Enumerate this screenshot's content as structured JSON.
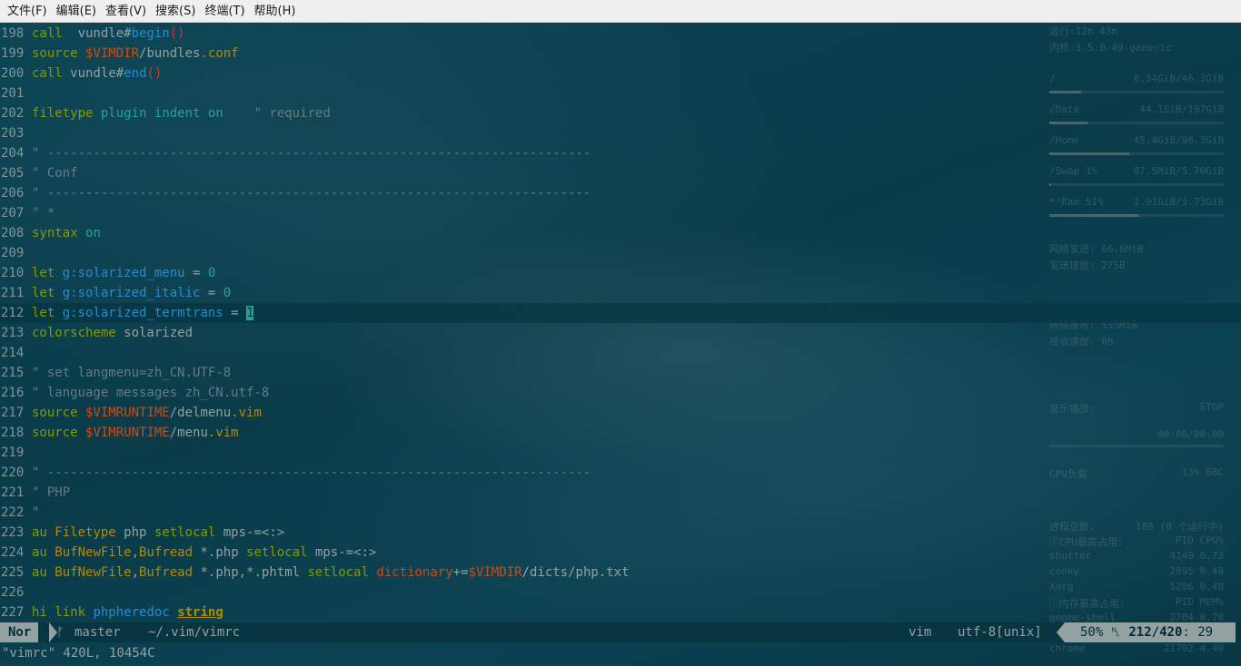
{
  "menu": [
    "文件(F)",
    "编辑(E)",
    "查看(V)",
    "搜索(S)",
    "终端(T)",
    "帮助(H)"
  ],
  "editor": {
    "lines": [
      {
        "n": "198",
        "segs": [
          [
            "kw",
            "call"
          ],
          [
            "",
            "  vundle#"
          ],
          [
            "fn",
            "begin"
          ],
          [
            "pr",
            "()"
          ]
        ]
      },
      {
        "n": "199",
        "segs": [
          [
            "kw",
            "source"
          ],
          [
            "",
            " "
          ],
          [
            "vr",
            "$VIMDIR"
          ],
          [
            "",
            "/bundles"
          ],
          [
            "ty",
            ".conf"
          ]
        ]
      },
      {
        "n": "200",
        "segs": [
          [
            "kw",
            "call"
          ],
          [
            "",
            " vundle#"
          ],
          [
            "fn",
            "end"
          ],
          [
            "pr",
            "()"
          ]
        ]
      },
      {
        "n": "201",
        "segs": []
      },
      {
        "n": "202",
        "segs": [
          [
            "kw",
            "filetype"
          ],
          [
            "",
            " "
          ],
          [
            "nm",
            "plugin"
          ],
          [
            "",
            " "
          ],
          [
            "nm",
            "indent"
          ],
          [
            "",
            " "
          ],
          [
            "nm",
            "on"
          ],
          [
            "cm",
            "    \" required"
          ]
        ]
      },
      {
        "n": "203",
        "segs": []
      },
      {
        "n": "204",
        "segs": [
          [
            "cm",
            "\" -----------------------------------------------------------------------"
          ]
        ]
      },
      {
        "n": "205",
        "segs": [
          [
            "cm",
            "\" Conf"
          ]
        ]
      },
      {
        "n": "206",
        "segs": [
          [
            "cm",
            "\" -----------------------------------------------------------------------"
          ]
        ]
      },
      {
        "n": "207",
        "segs": [
          [
            "cm",
            "\" *"
          ]
        ]
      },
      {
        "n": "208",
        "segs": [
          [
            "kw",
            "syntax"
          ],
          [
            "",
            " "
          ],
          [
            "nm",
            "on"
          ]
        ]
      },
      {
        "n": "209",
        "segs": []
      },
      {
        "n": "210",
        "segs": [
          [
            "kw",
            "let"
          ],
          [
            "",
            " "
          ],
          [
            "id",
            "g:solarized_menu"
          ],
          [
            "",
            " = "
          ],
          [
            "nm",
            "0"
          ]
        ]
      },
      {
        "n": "211",
        "segs": [
          [
            "kw",
            "let"
          ],
          [
            "",
            " "
          ],
          [
            "id",
            "g:solarized_italic"
          ],
          [
            "",
            " = "
          ],
          [
            "nm",
            "0"
          ]
        ]
      },
      {
        "n": "212",
        "current": true,
        "segs": [
          [
            "kw",
            "let"
          ],
          [
            "",
            " "
          ],
          [
            "id",
            "g:solarized_termtrans"
          ],
          [
            "",
            " = "
          ],
          [
            "cursor",
            "1"
          ]
        ]
      },
      {
        "n": "213",
        "segs": [
          [
            "kw",
            "colorscheme"
          ],
          [
            "",
            " solarized"
          ]
        ]
      },
      {
        "n": "214",
        "segs": []
      },
      {
        "n": "215",
        "segs": [
          [
            "cm",
            "\" set langmenu=zh_CN.UTF-8"
          ]
        ]
      },
      {
        "n": "216",
        "segs": [
          [
            "cm",
            "\" language messages zh_CN.utf-8"
          ]
        ]
      },
      {
        "n": "217",
        "segs": [
          [
            "kw",
            "source"
          ],
          [
            "",
            " "
          ],
          [
            "vr",
            "$VIMRUNTIME"
          ],
          [
            "",
            "/delmenu"
          ],
          [
            "ty",
            ".vim"
          ]
        ]
      },
      {
        "n": "218",
        "segs": [
          [
            "kw",
            "source"
          ],
          [
            "",
            " "
          ],
          [
            "vr",
            "$VIMRUNTIME"
          ],
          [
            "",
            "/menu"
          ],
          [
            "ty",
            ".vim"
          ]
        ]
      },
      {
        "n": "219",
        "segs": []
      },
      {
        "n": "220",
        "segs": [
          [
            "cm",
            "\" -----------------------------------------------------------------------"
          ]
        ]
      },
      {
        "n": "221",
        "segs": [
          [
            "cm",
            "\" PHP"
          ]
        ]
      },
      {
        "n": "222",
        "segs": [
          [
            "cm",
            "\""
          ]
        ]
      },
      {
        "n": "223",
        "segs": [
          [
            "kw",
            "au"
          ],
          [
            "",
            " "
          ],
          [
            "ty",
            "Filetype"
          ],
          [
            "",
            " php "
          ],
          [
            "kw",
            "setlocal"
          ],
          [
            "",
            " mps-=<:>"
          ]
        ]
      },
      {
        "n": "224",
        "segs": [
          [
            "kw",
            "au"
          ],
          [
            "",
            " "
          ],
          [
            "ty",
            "BufNewFile"
          ],
          [
            "",
            ","
          ],
          [
            "ty",
            "Bufread"
          ],
          [
            "",
            " *.php "
          ],
          [
            "kw",
            "setlocal"
          ],
          [
            "",
            " mps-=<:>"
          ]
        ]
      },
      {
        "n": "225",
        "segs": [
          [
            "kw",
            "au"
          ],
          [
            "",
            " "
          ],
          [
            "ty",
            "BufNewFile"
          ],
          [
            "",
            ","
          ],
          [
            "ty",
            "Bufread"
          ],
          [
            "",
            " *.php,*.phtml "
          ],
          [
            "kw",
            "setlocal"
          ],
          [
            "",
            " "
          ],
          [
            "vr",
            "dictionary"
          ],
          [
            "",
            "+="
          ],
          [
            "vr",
            "$VIMDIR"
          ],
          [
            "",
            "/dicts/php.txt"
          ]
        ]
      },
      {
        "n": "226",
        "segs": []
      },
      {
        "n": "227",
        "segs": [
          [
            "kw",
            "hi"
          ],
          [
            "",
            " "
          ],
          [
            "kw",
            "link"
          ],
          [
            "",
            " "
          ],
          [
            "id",
            "phpheredoc"
          ],
          [
            "",
            " "
          ],
          [
            "ul",
            "string"
          ]
        ]
      }
    ]
  },
  "conky": {
    "uptime": "运行:12h 43m",
    "kernel": "内核:3.5.0-49-generic",
    "root_label": "/",
    "root_usage": "8.34GiB/46.3GiB",
    "root_fill": 0.18,
    "data_label": "/Data",
    "data_usage": "44.1GiB/197GiB",
    "data_fill": 0.22,
    "home_label": "/Home",
    "home_usage": "45.4GiB/98.3GiB",
    "home_fill": 0.46,
    "swap_label": "/Swap  1%",
    "swap_usage": "87.5MiB/5.70GiB",
    "swap_fill": 0.01,
    "ram_label": "**Ram  51%",
    "ram_usage": "1.91GiB/3.73GiB",
    "ram_fill": 0.51,
    "net_sent": "网络发送: 66.6MiB",
    "up_speed": "发送速度: 275B",
    "net_recv": "网络接收: 555MiB",
    "down_speed": "接收速度: 0B",
    "music_label": "音乐播放:",
    "music_state": "STOP",
    "music_time": "00:00/00:00",
    "cpu_label": "CPU负载",
    "cpu_value": "13% 68C",
    "proc_total_label": "进程总数:",
    "proc_total": "188  (0 个运行中)",
    "cpu_top_label": "ⓘCPU最高占用:",
    "pid_head": "PID",
    "cpu_head": "CPU%",
    "cpu_procs": [
      {
        "name": "shutter",
        "pid": "4149",
        "val": "0.73"
      },
      {
        "name": "conky",
        "pid": "2895",
        "val": "0.48"
      },
      {
        "name": "Xorg",
        "pid": "1286",
        "val": "0.48"
      }
    ],
    "mem_top_label": "ⓘ内存最高占用:",
    "mem_head": "MEM%",
    "mem_procs": [
      {
        "name": "gnome-shell",
        "pid": "2704",
        "val": "8.70"
      },
      {
        "name": "chrome",
        "pid": "21792",
        "val": "4.40"
      }
    ]
  },
  "status": {
    "mode": "Nor",
    "branch_icon": "ᚠ",
    "branch": "master",
    "filepath": "~/.vim/vimrc",
    "filetype": "vim",
    "encoding": "utf-8[unix]",
    "percent": "50%",
    "ln_icon": "␤",
    "position": "212/420",
    "column": ": 29"
  },
  "cmdline": "\"vimrc\" 420L, 10454C"
}
